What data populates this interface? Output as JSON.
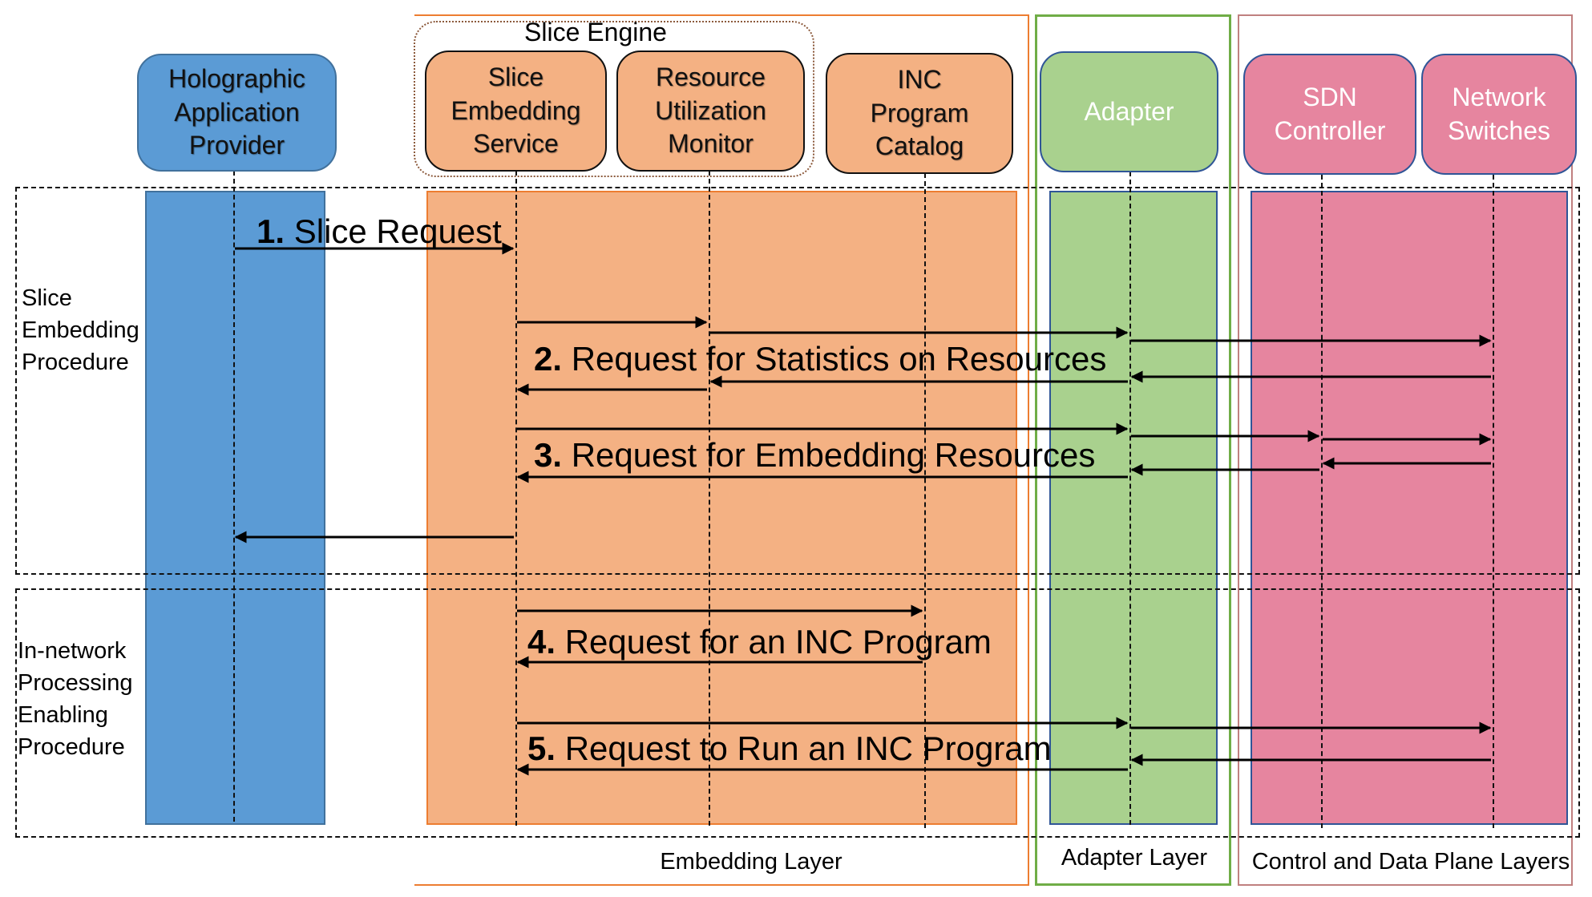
{
  "colors": {
    "app_blue": "#5b9bd5",
    "embedding_orange": "#f4b183",
    "embedding_border": "#ed7d31",
    "adapter_green": "#a9d18e",
    "adapter_border": "#70ad47",
    "cdp_pink": "#e6859f",
    "cdp_border": "#c0807f",
    "actor_border_blue": "#2f5597",
    "engine_dotted": "#8c5a3c"
  },
  "layers": {
    "embedding": "Embedding Layer",
    "adapter": "Adapter Layer",
    "control_data": "Control and Data Plane Layers"
  },
  "slice_engine_label": "Slice Engine",
  "actors": {
    "holographic": "Holographic\nApplication\nProvider",
    "ses": "Slice\nEmbedding\nService",
    "rum": "Resource\nUtilization\nMonitor",
    "inc": "INC\nProgram\nCatalog",
    "adapter": "Adapter",
    "sdn": "SDN\nController",
    "switches": "Network\nSwitches"
  },
  "procedures": {
    "slice_embedding": "Slice\nEmbedding\nProcedure",
    "inc_enabling": "In-network\nProcessing\nEnabling\nProcedure"
  },
  "steps": [
    {
      "num": "1.",
      "text": " Slice Request"
    },
    {
      "num": "2.",
      "text": " Request for Statistics on Resources"
    },
    {
      "num": "3.",
      "text": " Request for Embedding Resources"
    },
    {
      "num": "4.",
      "text": " Request for an INC Program"
    },
    {
      "num": "5.",
      "text": " Request to Run an INC Program"
    }
  ],
  "messages": [
    {
      "step": 1,
      "from": "holographic",
      "to": "ses"
    },
    {
      "step": 2,
      "from": "ses",
      "to": "rum"
    },
    {
      "step": 2,
      "from": "rum",
      "to": "adapter"
    },
    {
      "step": 2,
      "from": "adapter",
      "to": "switches"
    },
    {
      "step": 2,
      "from": "switches",
      "to": "adapter"
    },
    {
      "step": 2,
      "from": "adapter",
      "to": "rum"
    },
    {
      "step": 2,
      "from": "rum",
      "to": "ses"
    },
    {
      "step": 3,
      "from": "ses",
      "to": "adapter"
    },
    {
      "step": 3,
      "from": "adapter",
      "to": "sdn"
    },
    {
      "step": 3,
      "from": "sdn",
      "to": "switches"
    },
    {
      "step": 3,
      "from": "switches",
      "to": "sdn"
    },
    {
      "step": 3,
      "from": "sdn",
      "to": "adapter"
    },
    {
      "step": 3,
      "from": "adapter",
      "to": "ses"
    },
    {
      "step": 3,
      "from": "ses",
      "to": "holographic"
    },
    {
      "step": 4,
      "from": "ses",
      "to": "inc"
    },
    {
      "step": 4,
      "from": "inc",
      "to": "ses"
    },
    {
      "step": 5,
      "from": "ses",
      "to": "adapter"
    },
    {
      "step": 5,
      "from": "adapter",
      "to": "switches"
    },
    {
      "step": 5,
      "from": "switches",
      "to": "adapter"
    },
    {
      "step": 5,
      "from": "adapter",
      "to": "ses"
    }
  ]
}
